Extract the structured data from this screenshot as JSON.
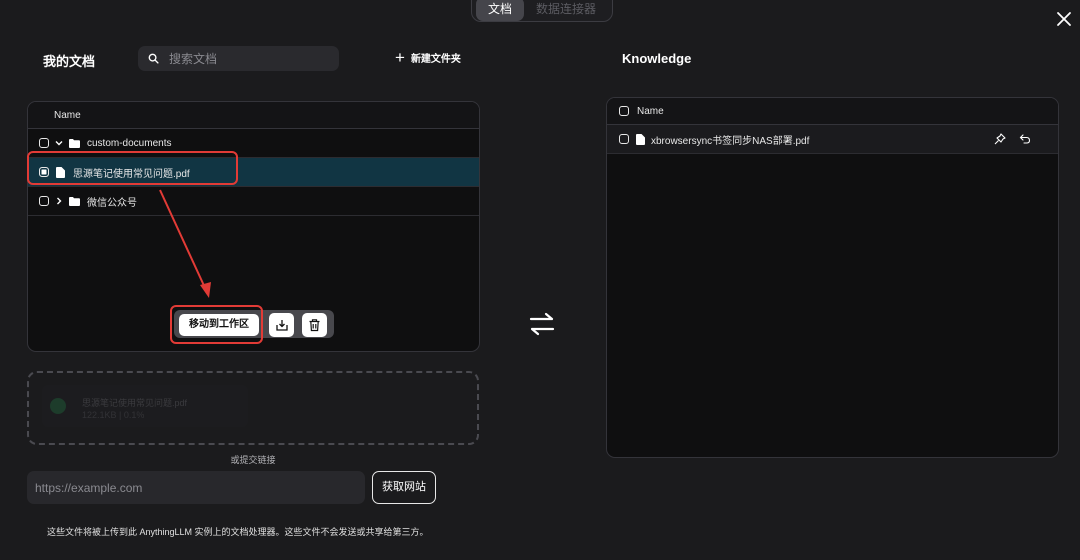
{
  "tabs": [
    {
      "label": "文档",
      "active": true
    },
    {
      "label": "数据连接器",
      "active": false
    }
  ],
  "left": {
    "title": "我的文档",
    "search_placeholder": "搜索文档",
    "new_folder_label": "新建文件夹",
    "table_header": "Name",
    "rows": [
      {
        "name": "custom-documents",
        "type": "folder",
        "expanded": true,
        "selected": false
      },
      {
        "name": "思源笔记使用常见问题.pdf",
        "type": "file",
        "selected": true
      },
      {
        "name": "微信公众号",
        "type": "folder",
        "expanded": false,
        "selected": false
      }
    ],
    "move_button": "移动到工作区",
    "upload": {
      "file_name": "思源笔记使用常见问题.pdf",
      "file_meta": "122.1KB | 0.1%"
    },
    "or_link_text": "或提交链接",
    "url_placeholder": "https://example.com",
    "fetch_button": "获取网站",
    "footer_note": "这些文件将被上传到此 AnythingLLM 实例上的文档处理器。这些文件不会发送或共享给第三方。"
  },
  "right": {
    "title": "Knowledge",
    "table_header": "Name",
    "rows": [
      {
        "name": "xbrowsersync书签同步NAS部署.pdf",
        "type": "file"
      }
    ]
  },
  "icons": [
    "close-icon",
    "search-icon",
    "plus-icon",
    "chevron-down-icon",
    "chevron-right-icon",
    "folder-icon",
    "file-icon",
    "download-icon",
    "trash-icon",
    "swap-arrows-icon",
    "pin-icon",
    "undo-icon"
  ],
  "colors": {
    "background": "#1b1b1d",
    "panel": "#0f0f10",
    "selected_row": "#113543",
    "annotation_red": "#e23b36"
  }
}
